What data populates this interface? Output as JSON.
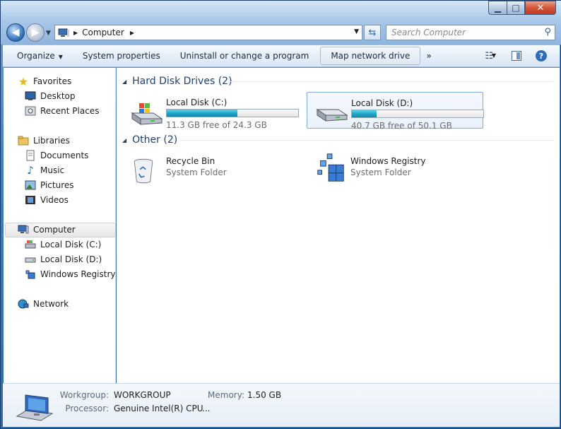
{
  "window": {
    "caption_buttons": {
      "minimize": "▁",
      "maximize": "□",
      "close": "✕"
    }
  },
  "navbar": {
    "back_icon": "back-arrow-icon",
    "forward_icon": "forward-arrow-icon",
    "address_crumb": "Computer",
    "search_placeholder": "Search Computer"
  },
  "toolbar": {
    "organize": "Organize",
    "system_properties": "System properties",
    "uninstall": "Uninstall or change a program",
    "map_network_drive": "Map network drive",
    "more": "»"
  },
  "nav": {
    "favorites": "Favorites",
    "desktop": "Desktop",
    "recent_places": "Recent Places",
    "libraries": "Libraries",
    "documents": "Documents",
    "music": "Music",
    "pictures": "Pictures",
    "videos": "Videos",
    "computer": "Computer",
    "local_disk_c": "Local Disk (C:)",
    "local_disk_d": "Local Disk (D:)",
    "windows_registry": "Windows Registry",
    "network": "Network"
  },
  "content": {
    "hdd_group": "Hard Disk Drives (2)",
    "other_group": "Other (2)",
    "drives": [
      {
        "name": "Local Disk (C:)",
        "free_text": "11.3 GB free of 24.3 GB",
        "used_fraction": 0.535
      },
      {
        "name": "Local Disk (D:)",
        "free_text": "40.7 GB free of 50.1 GB",
        "used_fraction": 0.188
      }
    ],
    "others": [
      {
        "name": "Recycle Bin",
        "type": "System Folder"
      },
      {
        "name": "Windows Registry",
        "type": "System Folder"
      }
    ]
  },
  "details": {
    "workgroup_label": "Workgroup:",
    "workgroup_value": "WORKGROUP",
    "memory_label": "Memory:",
    "memory_value": "1.50 GB",
    "processor_label": "Processor:",
    "processor_value": "Genuine Intel(R) CPU",
    "processor_more": "..."
  },
  "colors": {
    "accent": "#2d6db6",
    "disk_fill": "#21a7c8",
    "group_header": "#1e3f73"
  }
}
